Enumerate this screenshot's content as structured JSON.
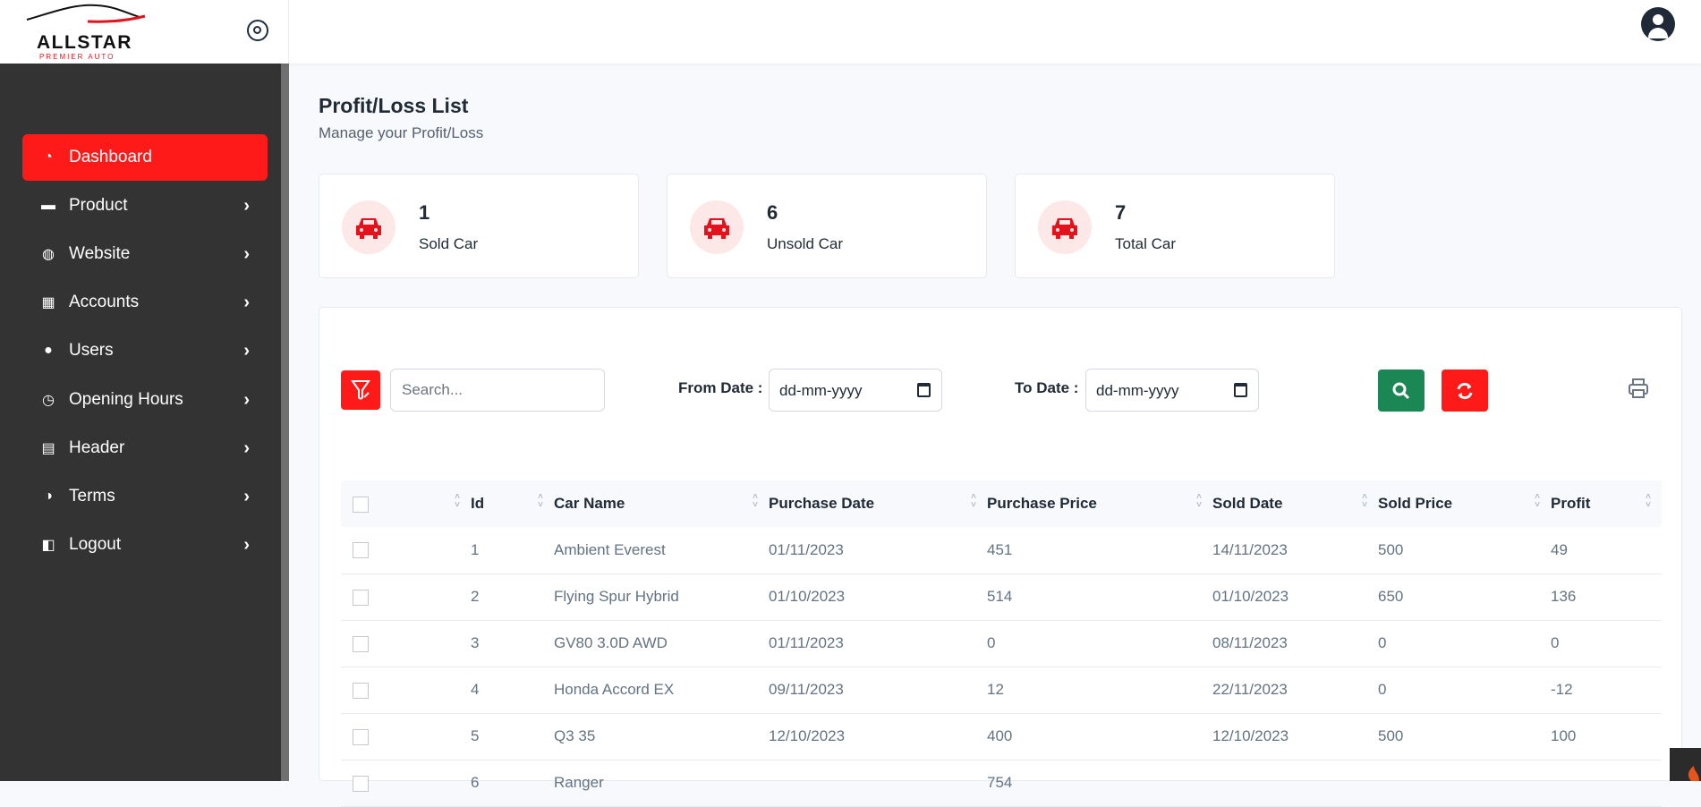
{
  "brand": {
    "name": "ALLSTAR",
    "tagline": "PREMIER AUTO"
  },
  "sidebar": {
    "items": [
      {
        "label": "Dashboard",
        "icon": "gauge-icon",
        "active": true,
        "has_submenu": false
      },
      {
        "label": "Product",
        "icon": "car-icon",
        "active": false,
        "has_submenu": true
      },
      {
        "label": "Website",
        "icon": "globe-icon",
        "active": false,
        "has_submenu": true
      },
      {
        "label": "Accounts",
        "icon": "calculator-icon",
        "active": false,
        "has_submenu": true
      },
      {
        "label": "Users",
        "icon": "users-icon",
        "active": false,
        "has_submenu": true
      },
      {
        "label": "Opening Hours",
        "icon": "clock-icon",
        "active": false,
        "has_submenu": true
      },
      {
        "label": "Header",
        "icon": "coins-icon",
        "active": false,
        "has_submenu": true
      },
      {
        "label": "Terms",
        "icon": "terms-icon",
        "active": false,
        "has_submenu": true
      },
      {
        "label": "Logout",
        "icon": "logout-icon",
        "active": false,
        "has_submenu": true
      }
    ]
  },
  "page": {
    "title": "Profit/Loss List",
    "subtitle": "Manage your Profit/Loss"
  },
  "stats": [
    {
      "value": "1",
      "label": "Sold Car"
    },
    {
      "value": "6",
      "label": "Unsold Car"
    },
    {
      "value": "7",
      "label": "Total Car"
    }
  ],
  "colors": {
    "accent": "#ff1a1a",
    "sidebar_bg": "#333333",
    "search_button": "#1b8754",
    "stat_badge_bg": "#fde8e8"
  },
  "toolbar": {
    "search_placeholder": "Search...",
    "from_date_label": "From Date :",
    "from_date_value": "dd-mm-yyyy",
    "to_date_label": "To Date :",
    "to_date_value": "dd-mm-yyyy"
  },
  "table": {
    "columns": [
      "Id",
      "Car Name",
      "Purchase Date",
      "Purchase Price",
      "Sold Date",
      "Sold Price",
      "Profit"
    ],
    "rows": [
      {
        "id": "1",
        "car_name": "Ambient Everest",
        "purchase_date": "01/11/2023",
        "purchase_price": "451",
        "sold_date": "14/11/2023",
        "sold_price": "500",
        "profit": "49"
      },
      {
        "id": "2",
        "car_name": "Flying Spur Hybrid",
        "purchase_date": "01/10/2023",
        "purchase_price": "514",
        "sold_date": "01/10/2023",
        "sold_price": "650",
        "profit": "136"
      },
      {
        "id": "3",
        "car_name": "GV80 3.0D AWD",
        "purchase_date": "01/11/2023",
        "purchase_price": "0",
        "sold_date": "08/11/2023",
        "sold_price": "0",
        "profit": "0"
      },
      {
        "id": "4",
        "car_name": "Honda Accord EX",
        "purchase_date": "09/11/2023",
        "purchase_price": "12",
        "sold_date": "22/11/2023",
        "sold_price": "0",
        "profit": "-12"
      },
      {
        "id": "5",
        "car_name": "Q3 35",
        "purchase_date": "12/10/2023",
        "purchase_price": "400",
        "sold_date": "12/10/2023",
        "sold_price": "500",
        "profit": "100"
      },
      {
        "id": "6",
        "car_name": "Ranger",
        "purchase_date": "",
        "purchase_price": "754",
        "sold_date": "",
        "sold_price": "",
        "profit": "",
        "clipped": true
      }
    ]
  }
}
